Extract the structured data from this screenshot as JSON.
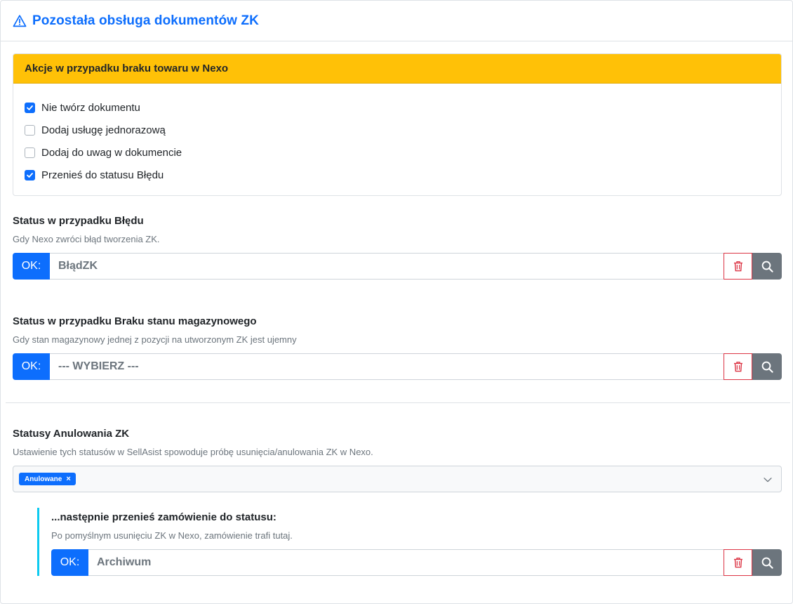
{
  "header": {
    "title": "Pozostała obsługa dokumentów ZK"
  },
  "missing_goods_panel": {
    "title": "Akcje w przypadku braku towaru w Nexo",
    "options": [
      {
        "label": "Nie twórz dokumentu",
        "checked": true
      },
      {
        "label": "Dodaj usługę jednorazową",
        "checked": false
      },
      {
        "label": "Dodaj do uwag w dokumencie",
        "checked": false
      },
      {
        "label": "Przenieś do statusu Błędu",
        "checked": true
      }
    ]
  },
  "error_status": {
    "label": "Status w przypadku Błędu",
    "help": "Gdy Nexo zwróci błąd tworzenia ZK.",
    "prefix": "OK:",
    "value": "BłądZK"
  },
  "stock_status": {
    "label": "Status w przypadku Braku stanu magazynowego",
    "help": "Gdy stan magazynowy jednej z pozycji na utworzonym ZK jest ujemny",
    "prefix": "OK:",
    "value": "--- WYBIERZ ---"
  },
  "cancel_statuses": {
    "label": "Statusy Anulowania ZK",
    "help": "Ustawienie tych statusów w SellAsist spowoduje próbę usunięcia/anulowania ZK w Nexo.",
    "tags": [
      {
        "label": "Anulowane",
        "remove": "×"
      }
    ]
  },
  "next_status": {
    "label": "...następnie przenieś zamówienie do statusu:",
    "help": "Po pomyślnym usunięciu ZK w Nexo, zamówienie trafi tutaj.",
    "prefix": "OK:",
    "value": "Archiwum"
  },
  "colors": {
    "primary": "#0d6efd",
    "warning": "#ffc107",
    "danger": "#dc3545",
    "secondary": "#6c757d",
    "info": "#0dcaf0"
  },
  "icons": {
    "header": "warning-triangle-icon",
    "delete": "trash-icon",
    "search": "magnifier-icon",
    "dropdown": "chevron-down-icon"
  }
}
